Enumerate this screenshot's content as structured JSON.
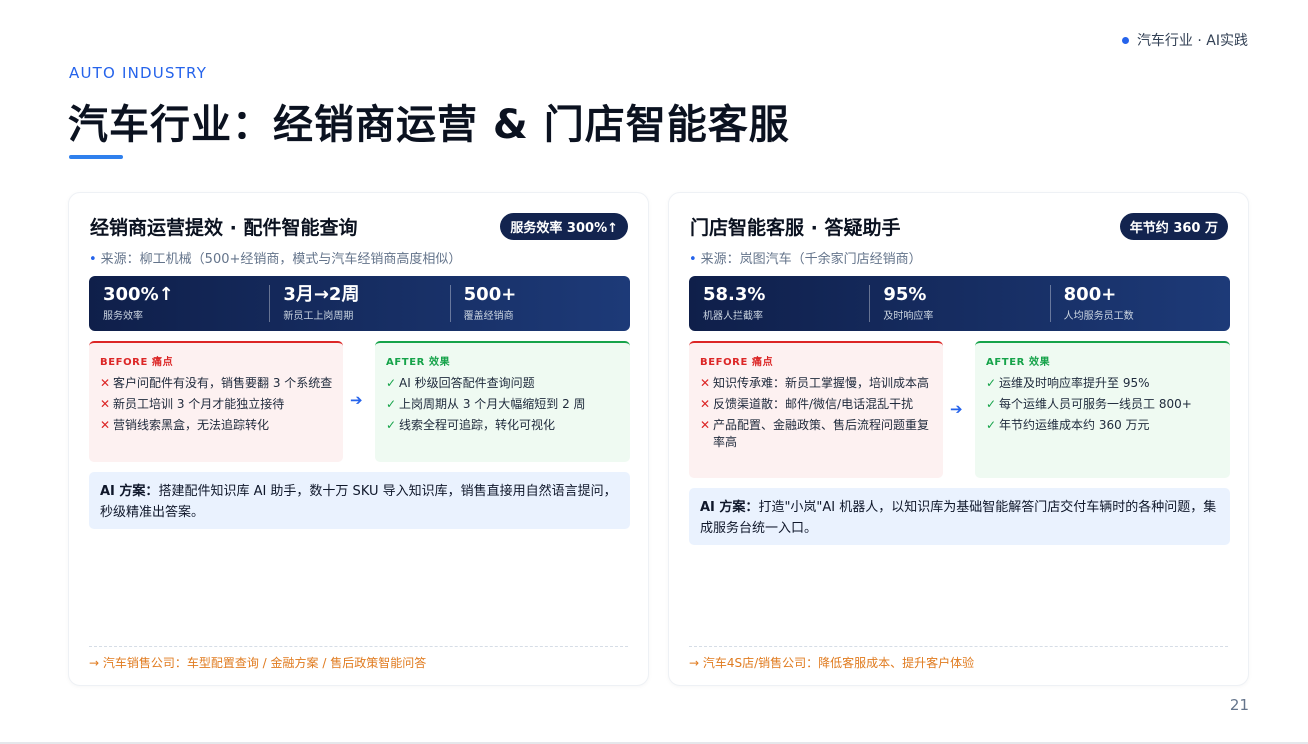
{
  "header": {
    "tag": "汽车行业 · AI实践",
    "eyebrow": "AUTO INDUSTRY",
    "title": "汽车行业：经销商运营 & 门店智能客服"
  },
  "cards": [
    {
      "title": "经销商运营提效 · 配件智能查询",
      "badge": "服务效率 300%↑",
      "source": "来源：柳工机械（500+经销商，模式与汽车经销商高度相似）",
      "stats": [
        {
          "value": "300%↑",
          "label": "服务效率"
        },
        {
          "value": "3月→2周",
          "label": "新员工上岗周期"
        },
        {
          "value": "500+",
          "label": "覆盖经销商"
        }
      ],
      "before": {
        "heading": "BEFORE 痛点",
        "items": [
          "客户问配件有没有，销售要翻 3 个系统查",
          "新员工培训 3 个月才能独立接待",
          "营销线索黑盒，无法追踪转化"
        ]
      },
      "after": {
        "heading": "AFTER 效果",
        "items": [
          "AI 秒级回答配件查询问题",
          "上岗周期从 3 个月大幅缩短到 2 周",
          "线索全程可追踪，转化可视化"
        ]
      },
      "ai": {
        "label": "AI 方案：",
        "text": "搭建配件知识库 AI 助手，数十万 SKU 导入知识库，销售直接用自然语言提问，秒级精准出答案。"
      },
      "footer": "→ 汽车销售公司：车型配置查询 / 金融方案 / 售后政策智能问答"
    },
    {
      "title": "门店智能客服 · 答疑助手",
      "badge": "年节约 360 万",
      "source": "来源：岚图汽车（千余家门店经销商）",
      "stats": [
        {
          "value": "58.3%",
          "label": "机器人拦截率"
        },
        {
          "value": "95%",
          "label": "及时响应率"
        },
        {
          "value": "800+",
          "label": "人均服务员工数"
        }
      ],
      "before": {
        "heading": "BEFORE 痛点",
        "items": [
          "知识传承难：新员工掌握慢，培训成本高",
          "反馈渠道散：邮件/微信/电话混乱干扰",
          "产品配置、金融政策、售后流程问题重复率高"
        ]
      },
      "after": {
        "heading": "AFTER 效果",
        "items": [
          "运维及时响应率提升至 95%",
          "每个运维人员可服务一线员工 800+",
          "年节约运维成本约 360 万元"
        ]
      },
      "ai": {
        "label": "AI 方案：",
        "text": "打造\"小岚\"AI 机器人，以知识库为基础智能解答门店交付车辆时的各种问题，集成服务台统一入口。"
      },
      "footer": "→ 汽车4S店/销售公司：降低客服成本、提升客户体验"
    }
  ],
  "page_number": "21",
  "icons": {
    "bullet": "•",
    "cross": "✕",
    "check": "✓",
    "arrow": "➔"
  }
}
